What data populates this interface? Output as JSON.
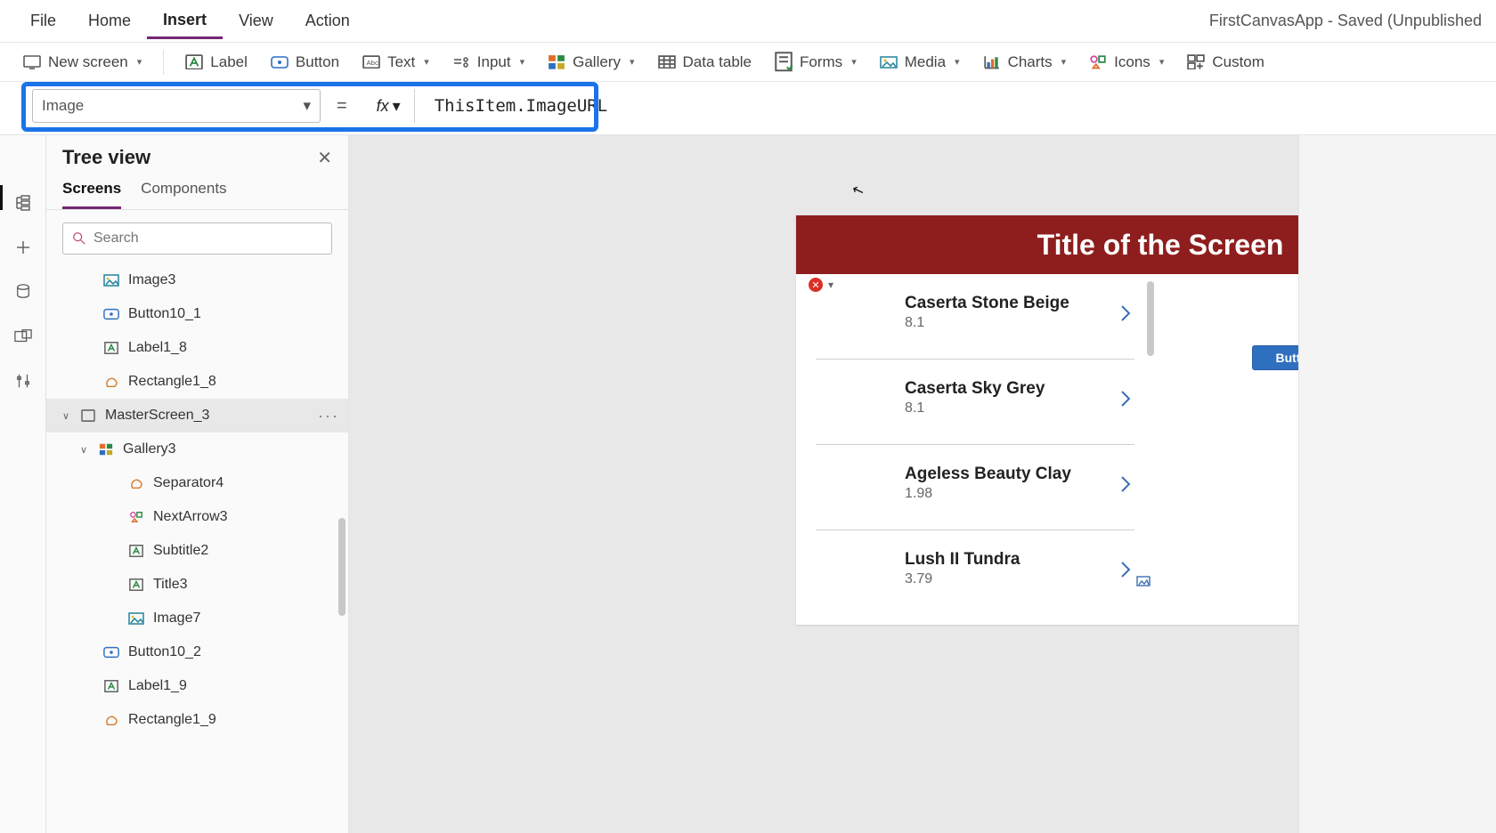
{
  "app_title": "FirstCanvasApp - Saved (Unpublished",
  "menu": {
    "file": "File",
    "home": "Home",
    "insert": "Insert",
    "view": "View",
    "action": "Action"
  },
  "ribbon": {
    "new_screen": "New screen",
    "label": "Label",
    "button": "Button",
    "text": "Text",
    "input": "Input",
    "gallery": "Gallery",
    "data_table": "Data table",
    "forms": "Forms",
    "media": "Media",
    "charts": "Charts",
    "icons": "Icons",
    "custom": "Custom"
  },
  "formula": {
    "property": "Image",
    "equals": "=",
    "fx": "fx",
    "expression": "ThisItem.ImageURL"
  },
  "tree": {
    "title": "Tree view",
    "tab_screens": "Screens",
    "tab_components": "Components",
    "search_placeholder": "Search",
    "nodes": [
      {
        "label": "Image3",
        "icon": "image",
        "indent": 42
      },
      {
        "label": "Button10_1",
        "icon": "button",
        "indent": 42
      },
      {
        "label": "Label1_8",
        "icon": "label",
        "indent": 42
      },
      {
        "label": "Rectangle1_8",
        "icon": "shape",
        "indent": 42
      },
      {
        "label": "MasterScreen_3",
        "icon": "screen",
        "indent": 16,
        "chev": "v",
        "sel": true,
        "more": true
      },
      {
        "label": "Gallery3",
        "icon": "gallery",
        "indent": 36,
        "chev": "v"
      },
      {
        "label": "Separator4",
        "icon": "shape",
        "indent": 70
      },
      {
        "label": "NextArrow3",
        "icon": "icons",
        "indent": 70
      },
      {
        "label": "Subtitle2",
        "icon": "label",
        "indent": 70
      },
      {
        "label": "Title3",
        "icon": "label",
        "indent": 70
      },
      {
        "label": "Image7",
        "icon": "image",
        "indent": 70
      },
      {
        "label": "Button10_2",
        "icon": "button",
        "indent": 42
      },
      {
        "label": "Label1_9",
        "icon": "label",
        "indent": 42
      },
      {
        "label": "Rectangle1_9",
        "icon": "shape",
        "indent": 42
      }
    ]
  },
  "canvas": {
    "screen_title": "Title of the Screen",
    "button_label": "Button",
    "gallery_rows": [
      {
        "title": "Caserta Stone Beige",
        "sub": "8.1"
      },
      {
        "title": "Caserta Sky Grey",
        "sub": "8.1"
      },
      {
        "title": "Ageless Beauty Clay",
        "sub": "1.98"
      },
      {
        "title": "Lush II Tundra",
        "sub": "3.79"
      }
    ]
  }
}
